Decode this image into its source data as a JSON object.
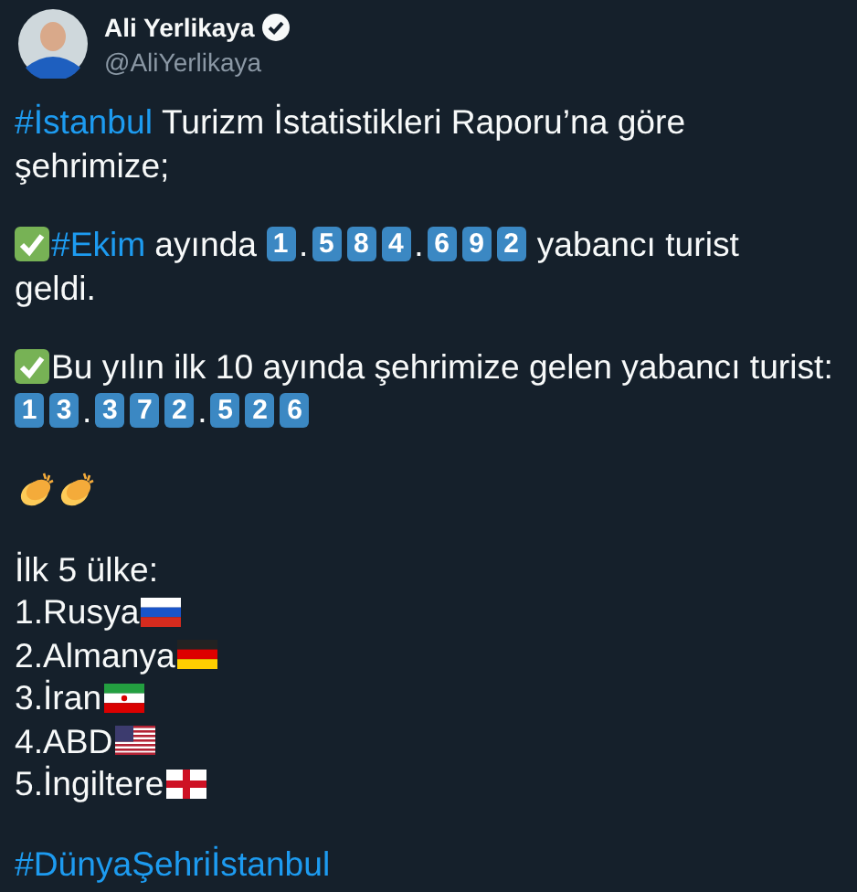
{
  "author": {
    "name": "Ali Yerlikaya",
    "handle": "@AliYerlikaya",
    "verified": true
  },
  "paragraphs": [
    [
      [
        {
          "kind": "hashtag",
          "text": "#İstanbul"
        },
        {
          "kind": "text",
          "text": "Turizm İstatistikleri Raporu’na göre"
        }
      ],
      [
        {
          "kind": "text",
          "text": "şehrimize;"
        }
      ]
    ],
    [
      [
        {
          "kind": "check"
        },
        {
          "kind": "hashtag",
          "text": "#Ekim"
        },
        {
          "kind": "text",
          "text": "ayında"
        },
        {
          "kind": "keycaps",
          "keys": [
            "1",
            ".",
            "5",
            "8",
            "4",
            ".",
            "6",
            "9",
            "2"
          ]
        },
        {
          "kind": "text",
          "text": "yabancı turist"
        }
      ],
      [
        {
          "kind": "text",
          "text": "geldi."
        }
      ]
    ],
    [
      [
        {
          "kind": "check"
        },
        {
          "kind": "text",
          "text": "Bu yılın ilk 10 ayında şehrimize gelen yabancı turist:"
        }
      ],
      [
        {
          "kind": "keycaps",
          "keys": [
            "1",
            "3",
            ".",
            "3",
            "7",
            "2",
            ".",
            "5",
            "2",
            "6"
          ]
        }
      ]
    ],
    [
      [
        {
          "kind": "clap"
        },
        {
          "kind": "clap"
        }
      ]
    ]
  ],
  "countries": {
    "title": "İlk 5 ülke:",
    "items": [
      {
        "text": "1.Rusya",
        "kind": "russia"
      },
      {
        "text": "2.Almanya",
        "kind": "germany"
      },
      {
        "text": "3.İran",
        "kind": "iran"
      },
      {
        "text": "4.ABD",
        "kind": "usa"
      },
      {
        "text": "5.İngiltere",
        "kind": "england"
      }
    ]
  },
  "footer_hashtag": "#DünyaŞehriİstanbul"
}
